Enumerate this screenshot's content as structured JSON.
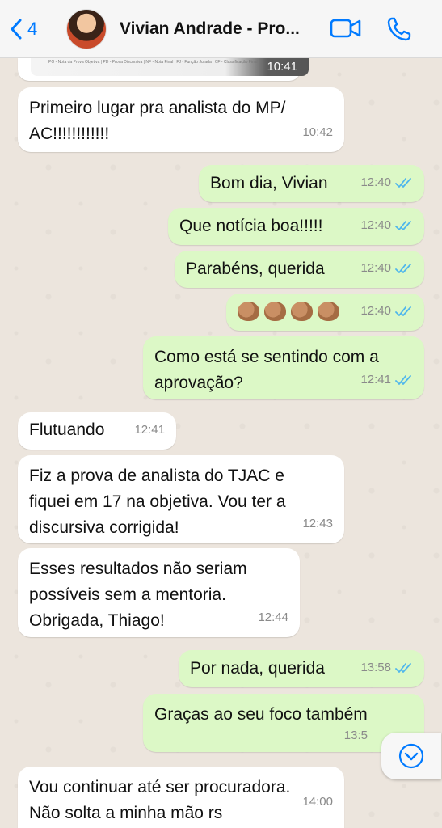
{
  "header": {
    "back_count": "4",
    "contact_name": "Vivian Andrade - Pro..."
  },
  "image_message": {
    "caption": "PO - Nota da Prova Objetiva | PD - Prova Discursiva | NF - Nota Final | FJ - Função Jurada | CF - Classificação Final",
    "time": "10:41"
  },
  "messages": [
    {
      "dir": "in",
      "text_lines": [
        "Primeiro lugar pra analista do MP/",
        "AC!!!!!!!!!!!!"
      ],
      "time": "10:42"
    },
    {
      "dir": "out",
      "text": "Bom dia, Vivian",
      "time": "12:40"
    },
    {
      "dir": "out",
      "text": "Que notícia boa!!!!!",
      "time": "12:40"
    },
    {
      "dir": "out",
      "text": "Parabéns, querida",
      "time": "12:40"
    },
    {
      "dir": "out",
      "emoji": "clapping-hands x4",
      "time": "12:40"
    },
    {
      "dir": "out",
      "text_lines": [
        "Como está se sentindo com a",
        "aprovação?"
      ],
      "time": "12:41"
    },
    {
      "dir": "in",
      "text": "Flutuando",
      "time": "12:41"
    },
    {
      "dir": "in",
      "text_lines": [
        "Fiz a prova de analista do TJAC e",
        "fiquei em 17 na objetiva. Vou ter a",
        "discursiva corrigida!"
      ],
      "time": "12:43"
    },
    {
      "dir": "in",
      "text_lines": [
        "Esses resultados não seriam",
        "possíveis sem a mentoria.",
        "Obrigada, Thiago!"
      ],
      "time": "12:44"
    },
    {
      "dir": "out",
      "text": "Por nada, querida",
      "time": "13:58"
    },
    {
      "dir": "out",
      "text": "Graças ao seu foco também",
      "time": "13:5"
    },
    {
      "dir": "in",
      "text_lines": [
        "Vou continuar até ser procuradora.",
        "Não solta a minha mão rs"
      ],
      "time": "14:00"
    }
  ],
  "colors": {
    "accent_blue": "#007aff",
    "outgoing_bubble": "#dcf8c6",
    "incoming_bubble": "#ffffff",
    "read_ticks": "#4fb6ec",
    "chat_background": "#ece5dd"
  },
  "icons": [
    "back-chevron-icon",
    "video-call-icon",
    "phone-icon",
    "double-check-read-icon",
    "scroll-down-chevron-icon"
  ]
}
